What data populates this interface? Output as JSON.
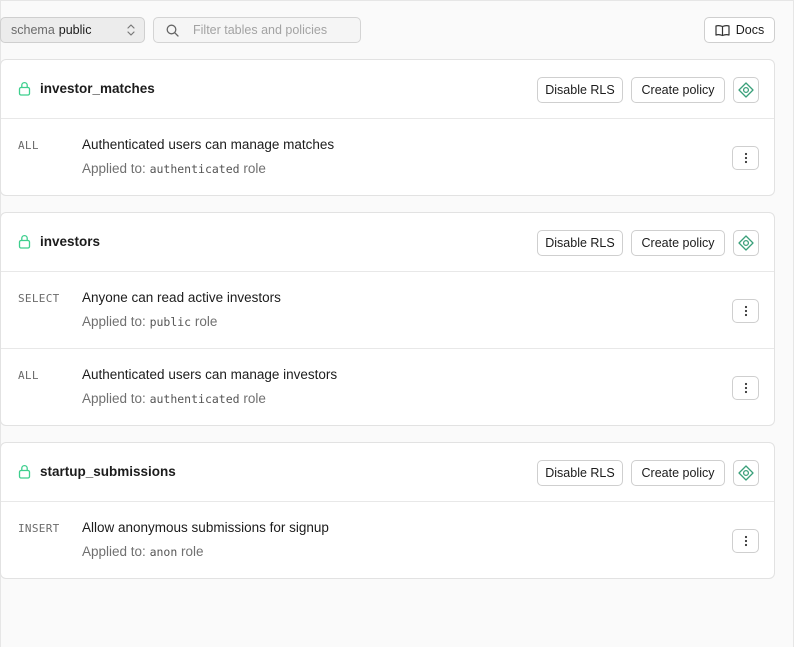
{
  "toolbar": {
    "schema_label": "schema",
    "schema_value": "public",
    "search_placeholder": "Filter tables and policies",
    "search_value": "",
    "docs_label": "Docs"
  },
  "colors": {
    "accent": "#3ecf8e",
    "border": "#e2e2e2",
    "muted_text": "#707070"
  },
  "tables": [
    {
      "name": "investor_matches",
      "disable_rls_label": "Disable RLS",
      "create_policy_label": "Create policy",
      "policies": [
        {
          "command": "ALL",
          "name": "Authenticated users can manage matches",
          "applied_prefix": "Applied to:",
          "role": "authenticated",
          "role_suffix": "role"
        }
      ]
    },
    {
      "name": "investors",
      "disable_rls_label": "Disable RLS",
      "create_policy_label": "Create policy",
      "policies": [
        {
          "command": "SELECT",
          "name": "Anyone can read active investors",
          "applied_prefix": "Applied to:",
          "role": "public",
          "role_suffix": "role"
        },
        {
          "command": "ALL",
          "name": "Authenticated users can manage investors",
          "applied_prefix": "Applied to:",
          "role": "authenticated",
          "role_suffix": "role"
        }
      ]
    },
    {
      "name": "startup_submissions",
      "disable_rls_label": "Disable RLS",
      "create_policy_label": "Create policy",
      "policies": [
        {
          "command": "INSERT",
          "name": "Allow anonymous submissions for signup",
          "applied_prefix": "Applied to:",
          "role": "anon",
          "role_suffix": "role"
        }
      ]
    }
  ]
}
